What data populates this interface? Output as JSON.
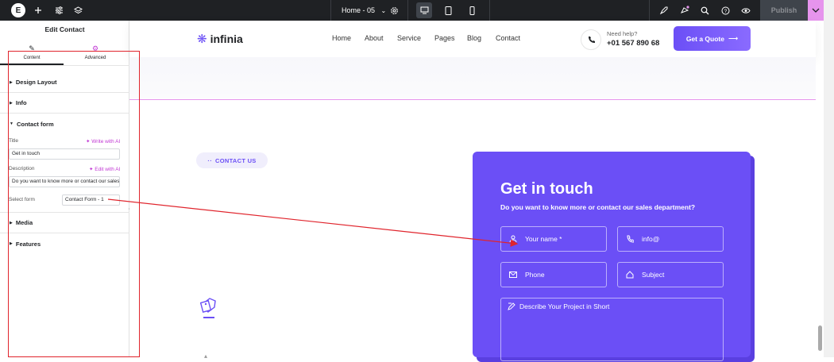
{
  "topbar": {
    "page_name": "Home - 05",
    "publish_label": "Publish",
    "icons": [
      "elementor-logo-icon",
      "add-icon",
      "settings-sliders-icon",
      "layers-icon",
      "gear-icon",
      "desktop-icon",
      "tablet-icon",
      "mobile-icon",
      "rocket-icon",
      "notifications-icon",
      "search-icon",
      "help-icon",
      "preview-eye-icon",
      "chevron-down-icon"
    ]
  },
  "panel": {
    "title": "Edit Contact",
    "tabs": [
      {
        "label": "Content",
        "icon": "pencil-icon"
      },
      {
        "label": "Advanced",
        "icon": "gear-icon"
      }
    ],
    "sections": {
      "design_layout": "Design Layout",
      "info": "Info",
      "contact_form": "Contact form",
      "media": "Media",
      "features": "Features"
    },
    "fields": {
      "title_label": "Title",
      "title_ai": "Write with AI",
      "title_value": "Get in touch",
      "description_label": "Description",
      "description_ai": "Edit with AI",
      "description_value": "Do you want to know more or contact our sales department?",
      "select_label": "Select form",
      "select_value": "Contact Form - 1"
    }
  },
  "site": {
    "brand": "infinia",
    "nav": [
      "Home",
      "About",
      "Service",
      "Pages",
      "Blog",
      "Contact"
    ],
    "need_help": "Need help?",
    "phone": "+01 567 890 68",
    "quote_button": "Get a Quote",
    "pill": "CONTACT US",
    "card": {
      "title": "Get in touch",
      "subtitle": "Do you want to know more or contact our sales department?",
      "name_placeholder": "Your name *",
      "email_placeholder": "info@",
      "phone_placeholder": "Phone",
      "subject_placeholder": "Subject",
      "message_placeholder": "Describe Your Project in Short"
    }
  },
  "colors": {
    "accent": "#6b4ff6",
    "ai_pink": "#c036d3",
    "annotation_red": "#e0242c",
    "topbar": "#1f2124"
  }
}
